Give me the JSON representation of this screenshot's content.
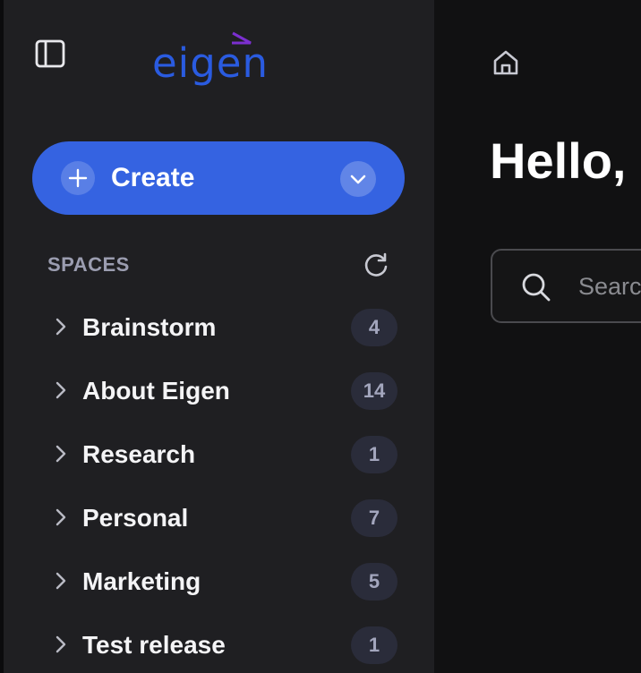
{
  "app": {
    "logo_text": "eigen",
    "brand_color": "#2a5be0",
    "accent_mark_color": "#7b2fd0"
  },
  "sidebar": {
    "toggle_icon": "sidebar-toggle-icon",
    "create": {
      "label": "Create",
      "icon": "plus-icon",
      "dropdown_icon": "chevron-down-icon",
      "color": "#3563e1"
    },
    "spaces": {
      "header": "SPACES",
      "refresh_icon": "refresh-icon",
      "items": [
        {
          "label": "Brainstorm",
          "count": "4"
        },
        {
          "label": "About Eigen",
          "count": "14"
        },
        {
          "label": "Research",
          "count": "1"
        },
        {
          "label": "Personal",
          "count": "7"
        },
        {
          "label": "Marketing",
          "count": "5"
        },
        {
          "label": "Test release",
          "count": "1"
        }
      ]
    }
  },
  "main": {
    "home_icon": "home-icon",
    "greeting": "Hello,",
    "search": {
      "placeholder": "Search",
      "value": "",
      "icon": "search-icon"
    }
  }
}
